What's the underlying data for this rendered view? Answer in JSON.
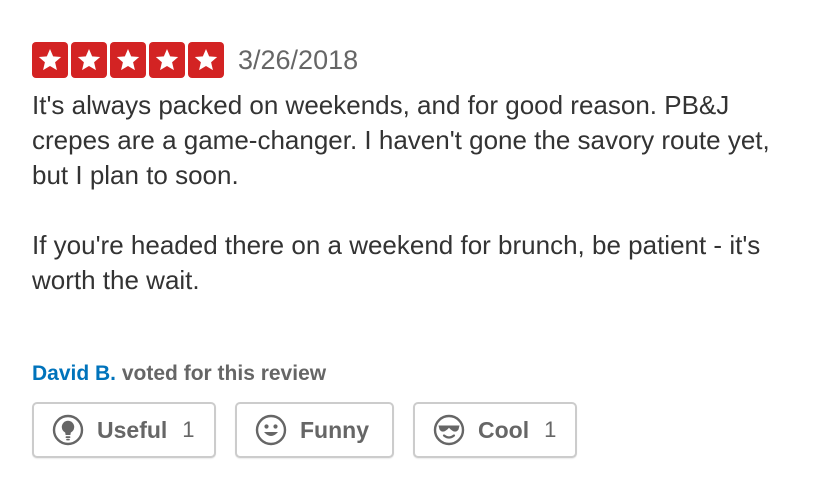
{
  "review": {
    "rating": 5,
    "max_rating": 5,
    "star_color": "#d32323",
    "date": "3/26/2018",
    "paragraphs": [
      "It's always packed on weekends, and for good reason. PB&J crepes are a game-changer. I haven't gone the savory route yet, but I plan to soon.",
      "If you're headed there on a weekend for brunch, be patient - it's worth the wait."
    ]
  },
  "votes": {
    "voter_name": "David B.",
    "voted_text": " voted for this review",
    "voter_color": "#0073bb"
  },
  "buttons": {
    "useful": {
      "label": "Useful",
      "count": "1",
      "icon": "lightbulb-icon"
    },
    "funny": {
      "label": "Funny",
      "count": "",
      "icon": "smiley-icon"
    },
    "cool": {
      "label": "Cool",
      "count": "1",
      "icon": "sunglasses-icon"
    }
  }
}
